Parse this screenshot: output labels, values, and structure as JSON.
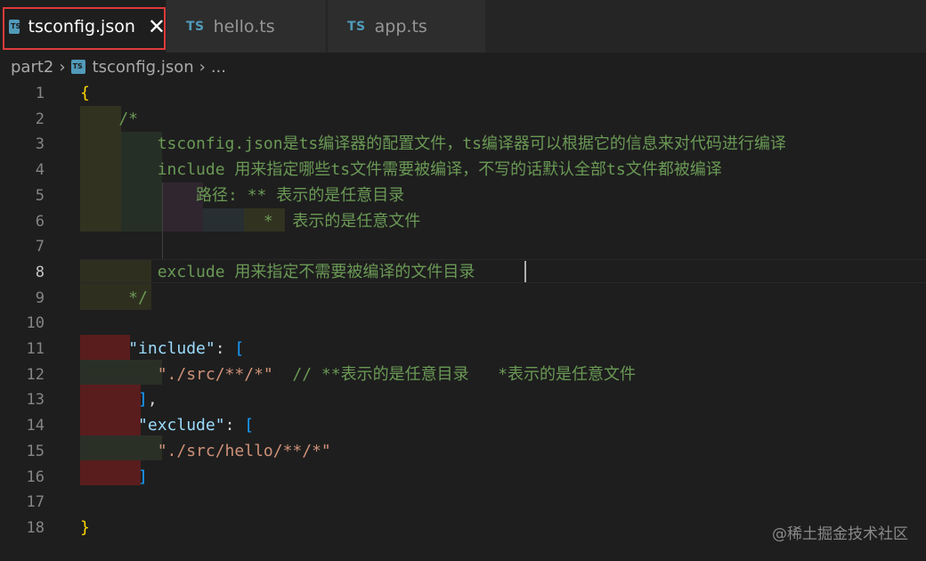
{
  "tabs": [
    {
      "icon": "TS",
      "label": "tsconfig.json",
      "active": true
    },
    {
      "icon": "TS",
      "label": "hello.ts",
      "active": false
    },
    {
      "icon": "TS",
      "label": "app.ts",
      "active": false
    }
  ],
  "close_glyph": "✕",
  "breadcrumb": {
    "folder": "part2",
    "file": "tsconfig.json",
    "more": "...",
    "separator": "›"
  },
  "line_numbers": [
    "1",
    "2",
    "3",
    "4",
    "5",
    "6",
    "7",
    "8",
    "9",
    "10",
    "11",
    "12",
    "13",
    "14",
    "15",
    "16",
    "17",
    "18"
  ],
  "current_line": 8,
  "code_lines": [
    {
      "n": 1,
      "segments": [
        {
          "t": "{",
          "c": "brace"
        }
      ]
    },
    {
      "n": 2,
      "segments": [
        {
          "t": "    /*",
          "c": "comment"
        }
      ]
    },
    {
      "n": 3,
      "segments": [
        {
          "t": "        tsconfig.json是ts编译器的配置文件，ts编译器可以根据它的信息来对代码进行编译",
          "c": "comment"
        }
      ]
    },
    {
      "n": 4,
      "segments": [
        {
          "t": "        include 用来指定哪些ts文件需要被编译，不写的话默认全部ts文件都被编译",
          "c": "comment"
        }
      ]
    },
    {
      "n": 5,
      "segments": [
        {
          "t": "            路径: ** 表示的是任意目录",
          "c": "comment"
        }
      ]
    },
    {
      "n": 6,
      "segments": [
        {
          "t": "                   *  表示的是任意文件",
          "c": "comment"
        }
      ]
    },
    {
      "n": 7,
      "segments": []
    },
    {
      "n": 8,
      "segments": [
        {
          "t": "        exclude 用来指定不需要被编译的文件目录",
          "c": "comment"
        }
      ]
    },
    {
      "n": 9,
      "segments": [
        {
          "t": "     */",
          "c": "comment"
        }
      ]
    },
    {
      "n": 10,
      "segments": []
    },
    {
      "n": 11,
      "segments": [
        {
          "t": "     ",
          "c": "punct"
        },
        {
          "t": "\"include\"",
          "c": "key"
        },
        {
          "t": ": ",
          "c": "punct"
        },
        {
          "t": "[",
          "c": "bracket"
        }
      ]
    },
    {
      "n": 12,
      "segments": [
        {
          "t": "        ",
          "c": "punct"
        },
        {
          "t": "\"./src/**/*\"",
          "c": "str"
        },
        {
          "t": "  // **表示的是任意目录   *表示的是任意文件",
          "c": "comment"
        }
      ]
    },
    {
      "n": 13,
      "segments": [
        {
          "t": "      ",
          "c": "punct"
        },
        {
          "t": "]",
          "c": "bracket"
        },
        {
          "t": ",",
          "c": "punct"
        }
      ]
    },
    {
      "n": 14,
      "segments": [
        {
          "t": "      ",
          "c": "punct"
        },
        {
          "t": "\"exclude\"",
          "c": "key"
        },
        {
          "t": ": ",
          "c": "punct"
        },
        {
          "t": "[",
          "c": "bracket"
        }
      ]
    },
    {
      "n": 15,
      "segments": [
        {
          "t": "        ",
          "c": "punct"
        },
        {
          "t": "\"./src/hello/**/*\"",
          "c": "str"
        }
      ]
    },
    {
      "n": 16,
      "segments": [
        {
          "t": "      ",
          "c": "punct"
        },
        {
          "t": "]",
          "c": "bracket"
        }
      ]
    },
    {
      "n": 17,
      "segments": []
    },
    {
      "n": 18,
      "segments": [
        {
          "t": "}",
          "c": "brace"
        }
      ]
    }
  ],
  "watermark": "@稀土掘金技术社区",
  "colors": {
    "editor_bg": "#1e1e1e",
    "tab_bar_bg": "#252526",
    "ts_icon": "#519aba",
    "comment": "#6a9955",
    "string": "#ce9178",
    "key": "#9cdcfe",
    "brace": "#ffd700",
    "bracket": "#179fff",
    "tab_highlight_border": "#e03a3a"
  }
}
